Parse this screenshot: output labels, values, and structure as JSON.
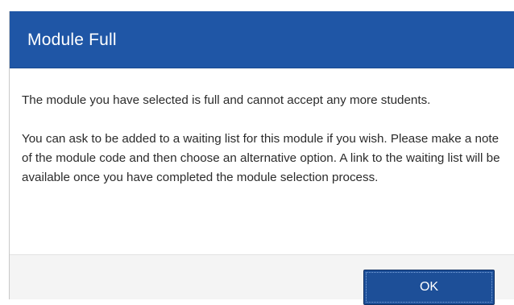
{
  "dialog": {
    "title": "Module Full",
    "paragraphs": [
      "The module you have selected is full and cannot accept any more students.",
      "You can ask to be added to a waiting list for this module if you wish. Please make a note of the module code and then choose an alternative option. A link to the waiting list will be available once you have completed the module selection process."
    ],
    "ok_label": "OK"
  },
  "colors": {
    "header_background": "#1f56a6",
    "button_background": "#1d4f98",
    "footer_background": "#f4f4f4",
    "body_text": "#2b2b2b"
  }
}
